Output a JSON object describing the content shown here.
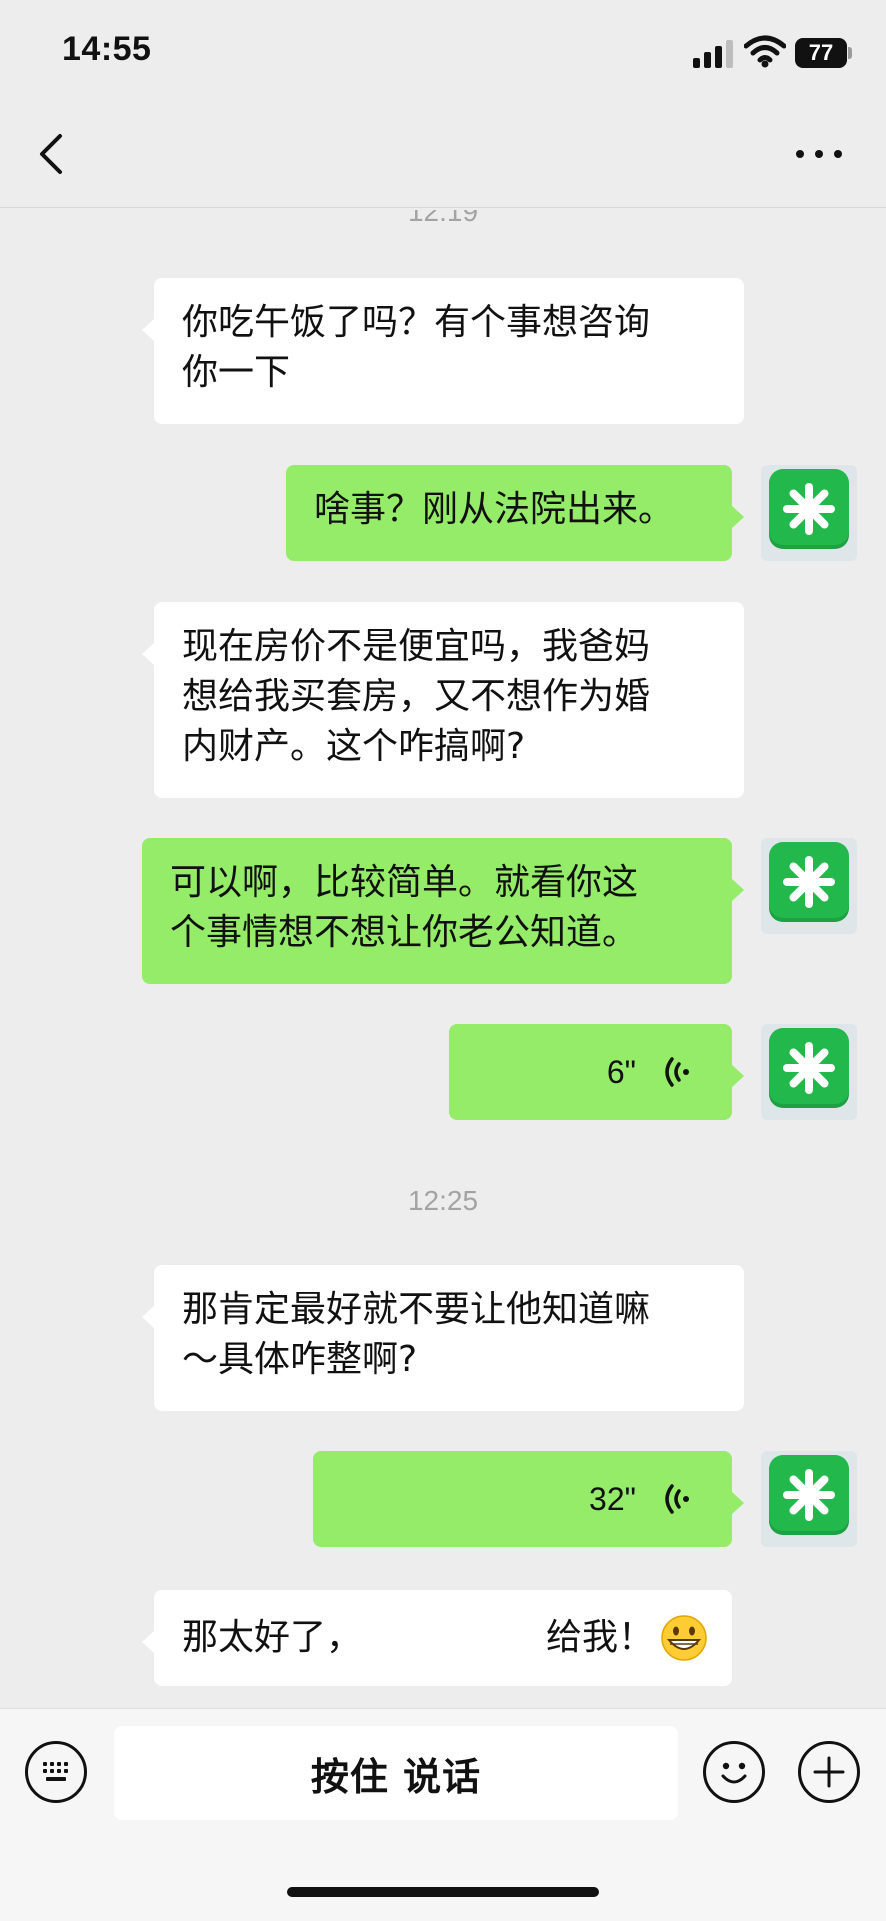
{
  "status_bar": {
    "time": "14:55",
    "battery": "77"
  },
  "nav": {
    "back_icon": "chevron-left-icon",
    "more_icon": "more-dots-icon"
  },
  "chat": {
    "timestamps": [
      "12:19",
      "12:25"
    ],
    "messages": [
      {
        "side": "left",
        "type": "text",
        "text": "你吃午饭了吗？有个事想咨询\n你一下"
      },
      {
        "side": "right",
        "type": "text",
        "text": "啥事？刚从法院出来。"
      },
      {
        "side": "left",
        "type": "text",
        "text": "现在房价不是便宜吗，我爸妈\n想给我买套房，又不想作为婚\n内财产。这个咋搞啊?"
      },
      {
        "side": "right",
        "type": "text",
        "text": "可以啊，比较简单。就看你这\n个事情想不想让你老公知道。"
      },
      {
        "side": "right",
        "type": "voice",
        "duration": "6\""
      },
      {
        "side": "left",
        "type": "text",
        "text": "那肯定最好就不要让他知道嘛\n～具体咋整啊?"
      },
      {
        "side": "right",
        "type": "voice",
        "duration": "32\""
      },
      {
        "side": "left",
        "type": "text",
        "text_start": "那太好了，",
        "text_end": "给我！",
        "emoji": "grinning-face-emoji"
      }
    ]
  },
  "input_bar": {
    "keyboard_icon": "keyboard-icon",
    "hold_to_talk": "按住 说话",
    "emoji_icon": "smiley-icon",
    "plus_icon": "plus-icon"
  },
  "colors": {
    "background": "#ededed",
    "bubble_incoming": "#ffffff",
    "bubble_outgoing": "#95ec69",
    "timestamp": "#a3a3a3",
    "avatar_icon": "#22b84c"
  }
}
